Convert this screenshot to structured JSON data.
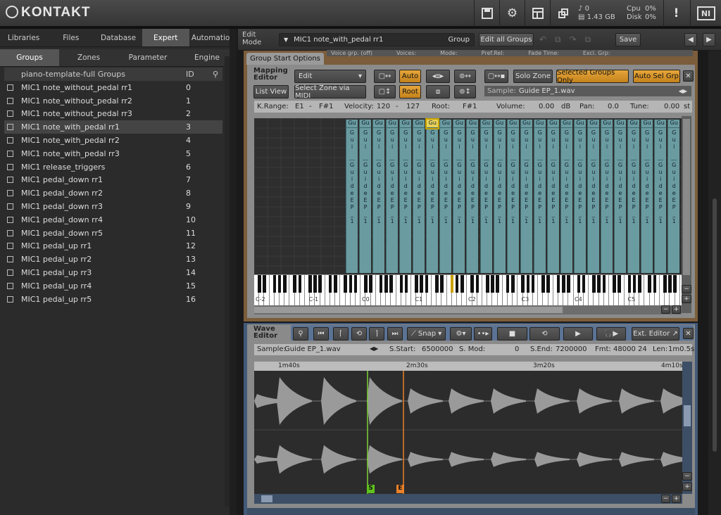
{
  "app": {
    "title": "KONTAKT",
    "status": {
      "midi": "0",
      "disk_size": "1.43 GB",
      "cpu_label": "Cpu",
      "cpu_value": "0%",
      "disk_label": "Disk",
      "disk_value": "0%"
    },
    "toolbar_icons": [
      "save-icon",
      "gear-icon",
      "layout-icon",
      "resize-icon",
      "warning-icon",
      "ni-logo-icon"
    ]
  },
  "left": {
    "tabs": [
      "Libraries",
      "Files",
      "Database",
      "Expert",
      "Automation"
    ],
    "subtabs": [
      "Groups",
      "Zones",
      "Parameter",
      "Engine"
    ],
    "header": {
      "name": "piano-template-full Groups",
      "id": "ID"
    },
    "groups": [
      {
        "name": "MIC1 note_without_pedal rr1",
        "id": "0"
      },
      {
        "name": "MIC1 note_without_pedal rr2",
        "id": "1"
      },
      {
        "name": "MIC1 note_without_pedal rr3",
        "id": "2"
      },
      {
        "name": "MIC1 note_with_pedal rr1",
        "id": "3"
      },
      {
        "name": "MIC1 note_with_pedal rr2",
        "id": "4"
      },
      {
        "name": "MIC1 note_with_pedal rr3",
        "id": "5"
      },
      {
        "name": "MIC1 release_triggers",
        "id": "6"
      },
      {
        "name": "MIC1 pedal_down rr1",
        "id": "7"
      },
      {
        "name": "MIC1 pedal_down rr2",
        "id": "8"
      },
      {
        "name": "MIC1 pedal_down rr3",
        "id": "9"
      },
      {
        "name": "MIC1 pedal_down rr4",
        "id": "10"
      },
      {
        "name": "MIC1 pedal_down rr5",
        "id": "11"
      },
      {
        "name": "MIC1 pedal_up rr1",
        "id": "12"
      },
      {
        "name": "MIC1 pedal_up rr2",
        "id": "13"
      },
      {
        "name": "MIC1 pedal_up rr3",
        "id": "14"
      },
      {
        "name": "MIC1 pedal_up rr4",
        "id": "15"
      },
      {
        "name": "MIC1 pedal_up rr5",
        "id": "16"
      }
    ]
  },
  "edit": {
    "label_line1": "Edit",
    "label_line2": "Mode",
    "group_name": "MIC1 note_with_pedal rr1",
    "group_label": "Group",
    "edit_all": "Edit all Groups",
    "save": "Save",
    "top_strip": [
      "Voice grp. (off)",
      "Voices:",
      "Mode:",
      "Pref.Rel:",
      "Fade Time:",
      "Excl. Grp:"
    ]
  },
  "mapping": {
    "tab": "Group Start Options",
    "title_line1": "Mapping",
    "title_line2": "Editor",
    "edit_dropdown": "Edit",
    "list_view": "List View",
    "select_midi": "Select Zone via MIDI",
    "auto": "Auto",
    "root": "Root",
    "solo_zone": "Solo Zone",
    "selected_groups": "Selected Groups Only",
    "auto_sel": "Auto Sel Grp",
    "sample_label": "Sample:",
    "sample_name": "Guide EP_1.wav",
    "params": {
      "krange_label": "K.Range:",
      "krange_lo": "E1",
      "krange_hi": "F#1",
      "vel_label": "Velocity:",
      "vel_lo": "120",
      "vel_hi": "127",
      "root_label": "Root:",
      "root_val": "F#1",
      "vol_label": "Volume:",
      "vol_val": "0.00",
      "vol_unit": "dB",
      "pan_label": "Pan:",
      "pan_val": "0.0",
      "tune_label": "Tune:",
      "tune_val": "0.00",
      "tune_unit": "st"
    },
    "zone_top_text": "Gu",
    "zone_col_top": "G u i",
    "zone_col_bottom": "G u i d e E P _ 1",
    "octaves": [
      "C-2",
      "C-1",
      "C0",
      "C1",
      "C2",
      "C3",
      "C4",
      "C5"
    ]
  },
  "wave": {
    "title_line1": "Wave",
    "title_line2": "Editor",
    "snap": "Snap",
    "ext_editor": "Ext. Editor",
    "sample_label": "Sample:",
    "sample_name": "Guide EP_1.wav",
    "sstart_label": "S.Start:",
    "sstart": "6500000",
    "smod_label": "S. Mod:",
    "smod": "0",
    "send_label": "S.End:",
    "send": "7200000",
    "fmt_label": "Fmt:",
    "fmt": "48000  24",
    "len_label": "Len:",
    "len": "1m0.5s",
    "ruler": [
      "1m40s",
      "2m30s",
      "3m20s",
      "4m10s"
    ],
    "marker_s": "S",
    "marker_e": "E"
  }
}
